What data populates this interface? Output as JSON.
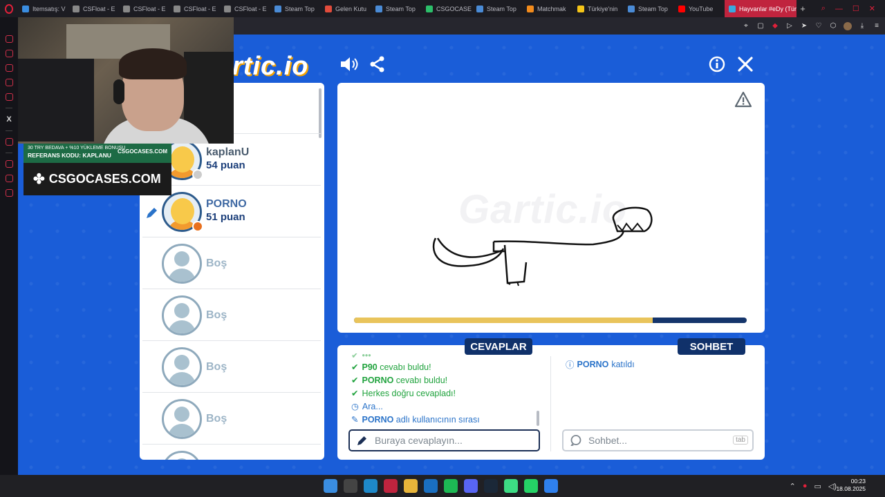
{
  "browser": {
    "tabs": [
      {
        "label": "Itemsatış: V",
        "icon_color": "#3a8de0"
      },
      {
        "label": "CSFloat - E",
        "icon_color": "#888888"
      },
      {
        "label": "CSFloat - E",
        "icon_color": "#888888"
      },
      {
        "label": "CSFloat - E",
        "icon_color": "#888888"
      },
      {
        "label": "CSFloat - E",
        "icon_color": "#888888"
      },
      {
        "label": "Steam Top",
        "icon_color": "#4a8bd6"
      },
      {
        "label": "Gelen Kutu",
        "icon_color": "#e24c3c"
      },
      {
        "label": "Steam Top",
        "icon_color": "#4a8bd6"
      },
      {
        "label": "CSGOCASE",
        "icon_color": "#2cbf6a"
      },
      {
        "label": "Steam Top",
        "icon_color": "#4a8bd6"
      },
      {
        "label": "Matchmak",
        "icon_color": "#f28b1c"
      },
      {
        "label": "Türkiye'nin",
        "icon_color": "#f5c518"
      },
      {
        "label": "Steam Top",
        "icon_color": "#4a8bd6"
      },
      {
        "label": "YouTube",
        "icon_color": "#ff0000"
      }
    ],
    "active_tab": "Hayvanlar #eDy (Tür",
    "accent": "#c0243e"
  },
  "game": {
    "logo": "rtic.io",
    "players": [
      {
        "name": "",
        "score": "uan",
        "type": "partial"
      },
      {
        "name": "kaplanU",
        "score": "54 puan",
        "status_color": "#cccccc"
      },
      {
        "name": "PORNO",
        "score": "51 puan",
        "status_color": "#e8701e",
        "drawing": true
      },
      {
        "name": "Boş",
        "empty": true
      },
      {
        "name": "Boş",
        "empty": true
      },
      {
        "name": "Boş",
        "empty": true
      },
      {
        "name": "Boş",
        "empty": true
      }
    ],
    "watermark": "Gartic.io",
    "progress": 0.76,
    "answers_label": "CEVAPLAR",
    "chat_label": "SOHBET",
    "messages": [
      {
        "nm": "P90",
        "text": " cevabı buldu!",
        "kind": "green"
      },
      {
        "nm": "PORNO",
        "text": " cevabı buldu!",
        "kind": "green"
      },
      {
        "nm": "",
        "text": "Herkes doğru cevapladı!",
        "kind": "green"
      },
      {
        "nm": "",
        "text": "Ara...",
        "kind": "blue-clock"
      },
      {
        "nm": "PORNO",
        "text": " adlı kullanıcının sırası",
        "kind": "blue-pencil"
      }
    ],
    "chat_join": {
      "nm": "PORNO",
      "text": "katıldı"
    },
    "answer_placeholder": "Buraya cevaplayın...",
    "chat_placeholder": "Sohbet...",
    "tab_hint": "tab"
  },
  "overlay": {
    "banner_top": "30 TRY BEDAVA + %10 YÜKLEME BONUSU",
    "banner_ref": "REFERANS KODU: KAPLANU",
    "banner_brand_small": "CSGOCASES.COM",
    "banner_brand": "CSGOCASES.COM"
  },
  "taskbar": {
    "time": "00:23",
    "date": "18.08.2025"
  }
}
